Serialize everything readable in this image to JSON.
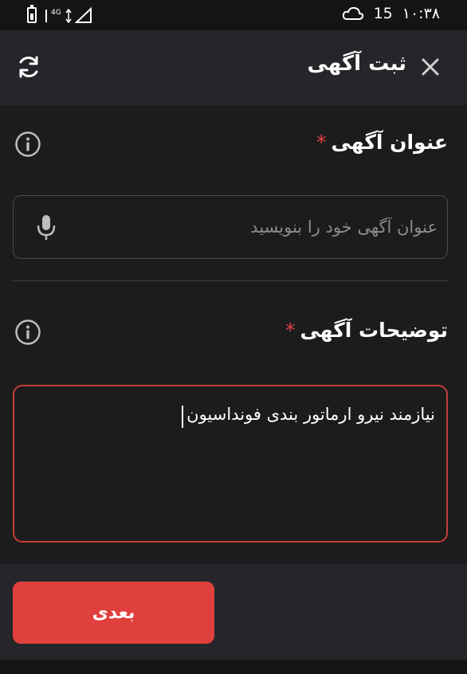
{
  "status_bar": {
    "network": "4G",
    "temperature": "15",
    "time": "۱۰:۳۸"
  },
  "app_bar": {
    "title": "ثبت آگهی"
  },
  "form": {
    "title_field": {
      "label": "عنوان آگهی",
      "required_mark": "*",
      "placeholder": "عنوان آگهی خود را بنویسید",
      "value": ""
    },
    "description_field": {
      "label": "توضیحات آگهی",
      "required_mark": "*",
      "value": "نیازمند نیرو ارماتور بندی فونداسیون"
    }
  },
  "actions": {
    "next_label": "بعدی"
  },
  "colors": {
    "accent": "#e0403d",
    "background": "#1c1c1e",
    "surface": "#26262a"
  },
  "icons": [
    "battery-icon",
    "signal-icon",
    "cloud-icon",
    "close-icon",
    "refresh-icon",
    "info-icon",
    "mic-icon"
  ]
}
